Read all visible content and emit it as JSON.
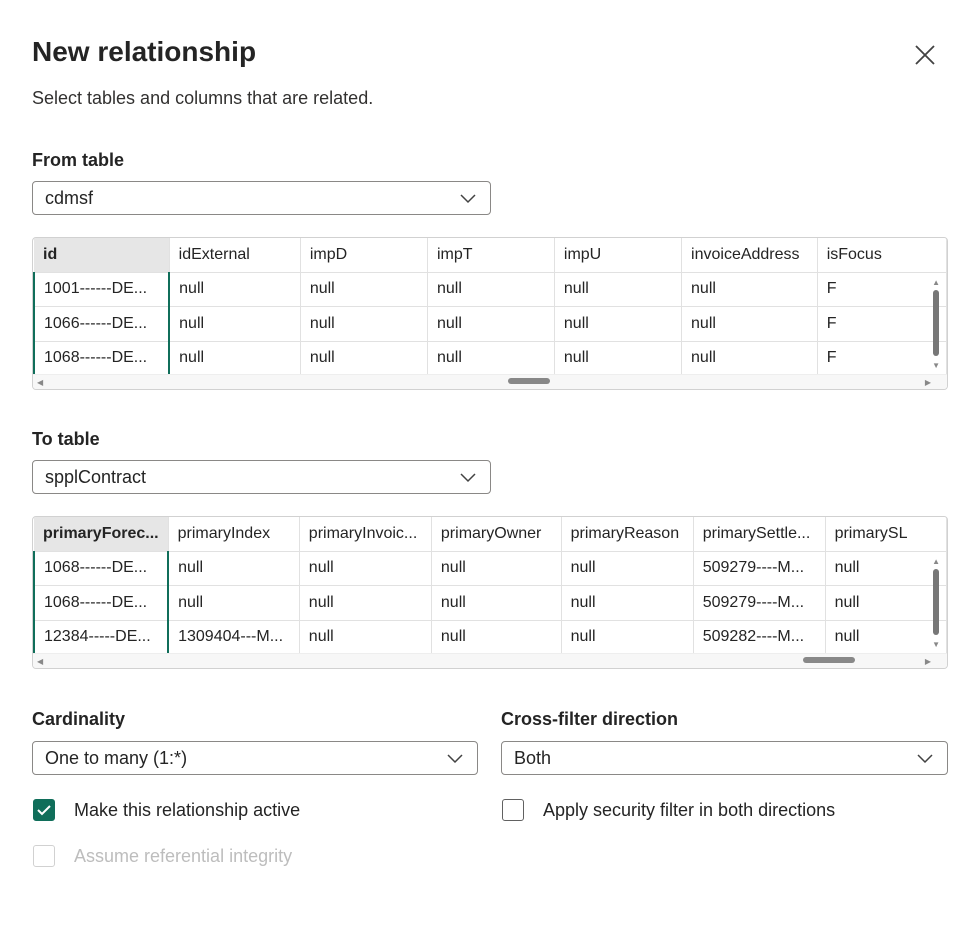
{
  "dialog": {
    "title": "New relationship",
    "subtitle": "Select tables and columns that are related.",
    "close_icon": "close-icon"
  },
  "from_table": {
    "label": "From table",
    "selected": "cdmsf",
    "columns": [
      "id",
      "idExternal",
      "impD",
      "impT",
      "impU",
      "invoiceAddress",
      "isFocus"
    ],
    "rows": [
      [
        "1001------DE...",
        "null",
        "null",
        "null",
        "null",
        "null",
        "F"
      ],
      [
        "1066------DE...",
        "null",
        "null",
        "null",
        "null",
        "null",
        "F"
      ],
      [
        "1068------DE...",
        "null",
        "null",
        "null",
        "null",
        "null",
        "F"
      ]
    ]
  },
  "to_table": {
    "label": "To table",
    "selected": "spplContract",
    "columns": [
      "primaryForec...",
      "primaryIndex",
      "primaryInvoic...",
      "primaryOwner",
      "primaryReason",
      "primarySettle...",
      "primarySL"
    ],
    "rows": [
      [
        "1068------DE...",
        "null",
        "null",
        "null",
        "null",
        "509279----M...",
        "null"
      ],
      [
        "1068------DE...",
        "null",
        "null",
        "null",
        "null",
        "509279----M...",
        "null"
      ],
      [
        "12384-----DE...",
        "1309404---M...",
        "null",
        "null",
        "null",
        "509282----M...",
        "null"
      ]
    ]
  },
  "cardinality": {
    "label": "Cardinality",
    "selected": "One to many (1:*)"
  },
  "cross_filter": {
    "label": "Cross-filter direction",
    "selected": "Both"
  },
  "options": {
    "active_label": "Make this relationship active",
    "active_checked": true,
    "security_label": "Apply security filter in both directions",
    "security_checked": false,
    "integrity_label": "Assume referential integrity",
    "integrity_disabled": true
  },
  "colors": {
    "accent": "#106e5a",
    "header_selected": "#e6e6e6",
    "border": "#8a8886"
  }
}
